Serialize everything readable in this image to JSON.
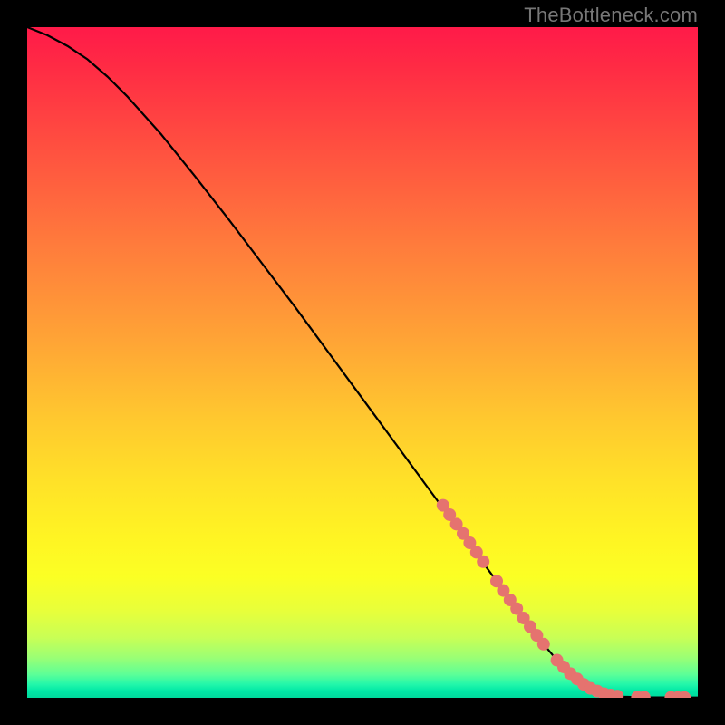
{
  "watermark": "TheBottleneck.com",
  "colors": {
    "line": "#000000",
    "marker_fill": "#e5736f",
    "marker_stroke": "#e5736f"
  },
  "chart_data": {
    "type": "line",
    "title": "",
    "xlabel": "",
    "ylabel": "",
    "xlim": [
      0,
      100
    ],
    "ylim": [
      0,
      100
    ],
    "grid": false,
    "legend": false,
    "series": [
      {
        "name": "curve",
        "style": "line",
        "x": [
          0,
          3,
          6,
          9,
          12,
          15,
          20,
          25,
          30,
          35,
          40,
          45,
          50,
          55,
          60,
          65,
          70,
          73,
          75,
          77,
          79,
          81,
          83,
          85,
          87,
          89,
          91,
          93,
          95,
          97,
          99,
          100
        ],
        "y": [
          100,
          98.8,
          97.2,
          95.2,
          92.6,
          89.6,
          84.0,
          77.8,
          71.4,
          64.8,
          58.2,
          51.4,
          44.6,
          37.8,
          31.0,
          24.2,
          17.4,
          13.3,
          10.6,
          8.0,
          5.6,
          3.6,
          2.0,
          1.0,
          0.4,
          0.15,
          0.08,
          0.06,
          0.05,
          0.04,
          0.03,
          0.03
        ]
      },
      {
        "name": "highlight-markers",
        "style": "scatter",
        "x": [
          62,
          63,
          64,
          65,
          66,
          67,
          68,
          70,
          71,
          72,
          73,
          74,
          75,
          76,
          77,
          79,
          80,
          81,
          82,
          83,
          84,
          85,
          86,
          87,
          88,
          91,
          92,
          96,
          97,
          98
        ],
        "y": [
          28.7,
          27.3,
          25.9,
          24.5,
          23.1,
          21.7,
          20.3,
          17.4,
          16.0,
          14.6,
          13.3,
          11.9,
          10.6,
          9.3,
          8.0,
          5.6,
          4.6,
          3.6,
          2.8,
          2.0,
          1.4,
          1.0,
          0.6,
          0.4,
          0.25,
          0.09,
          0.08,
          0.05,
          0.04,
          0.03
        ]
      }
    ]
  }
}
